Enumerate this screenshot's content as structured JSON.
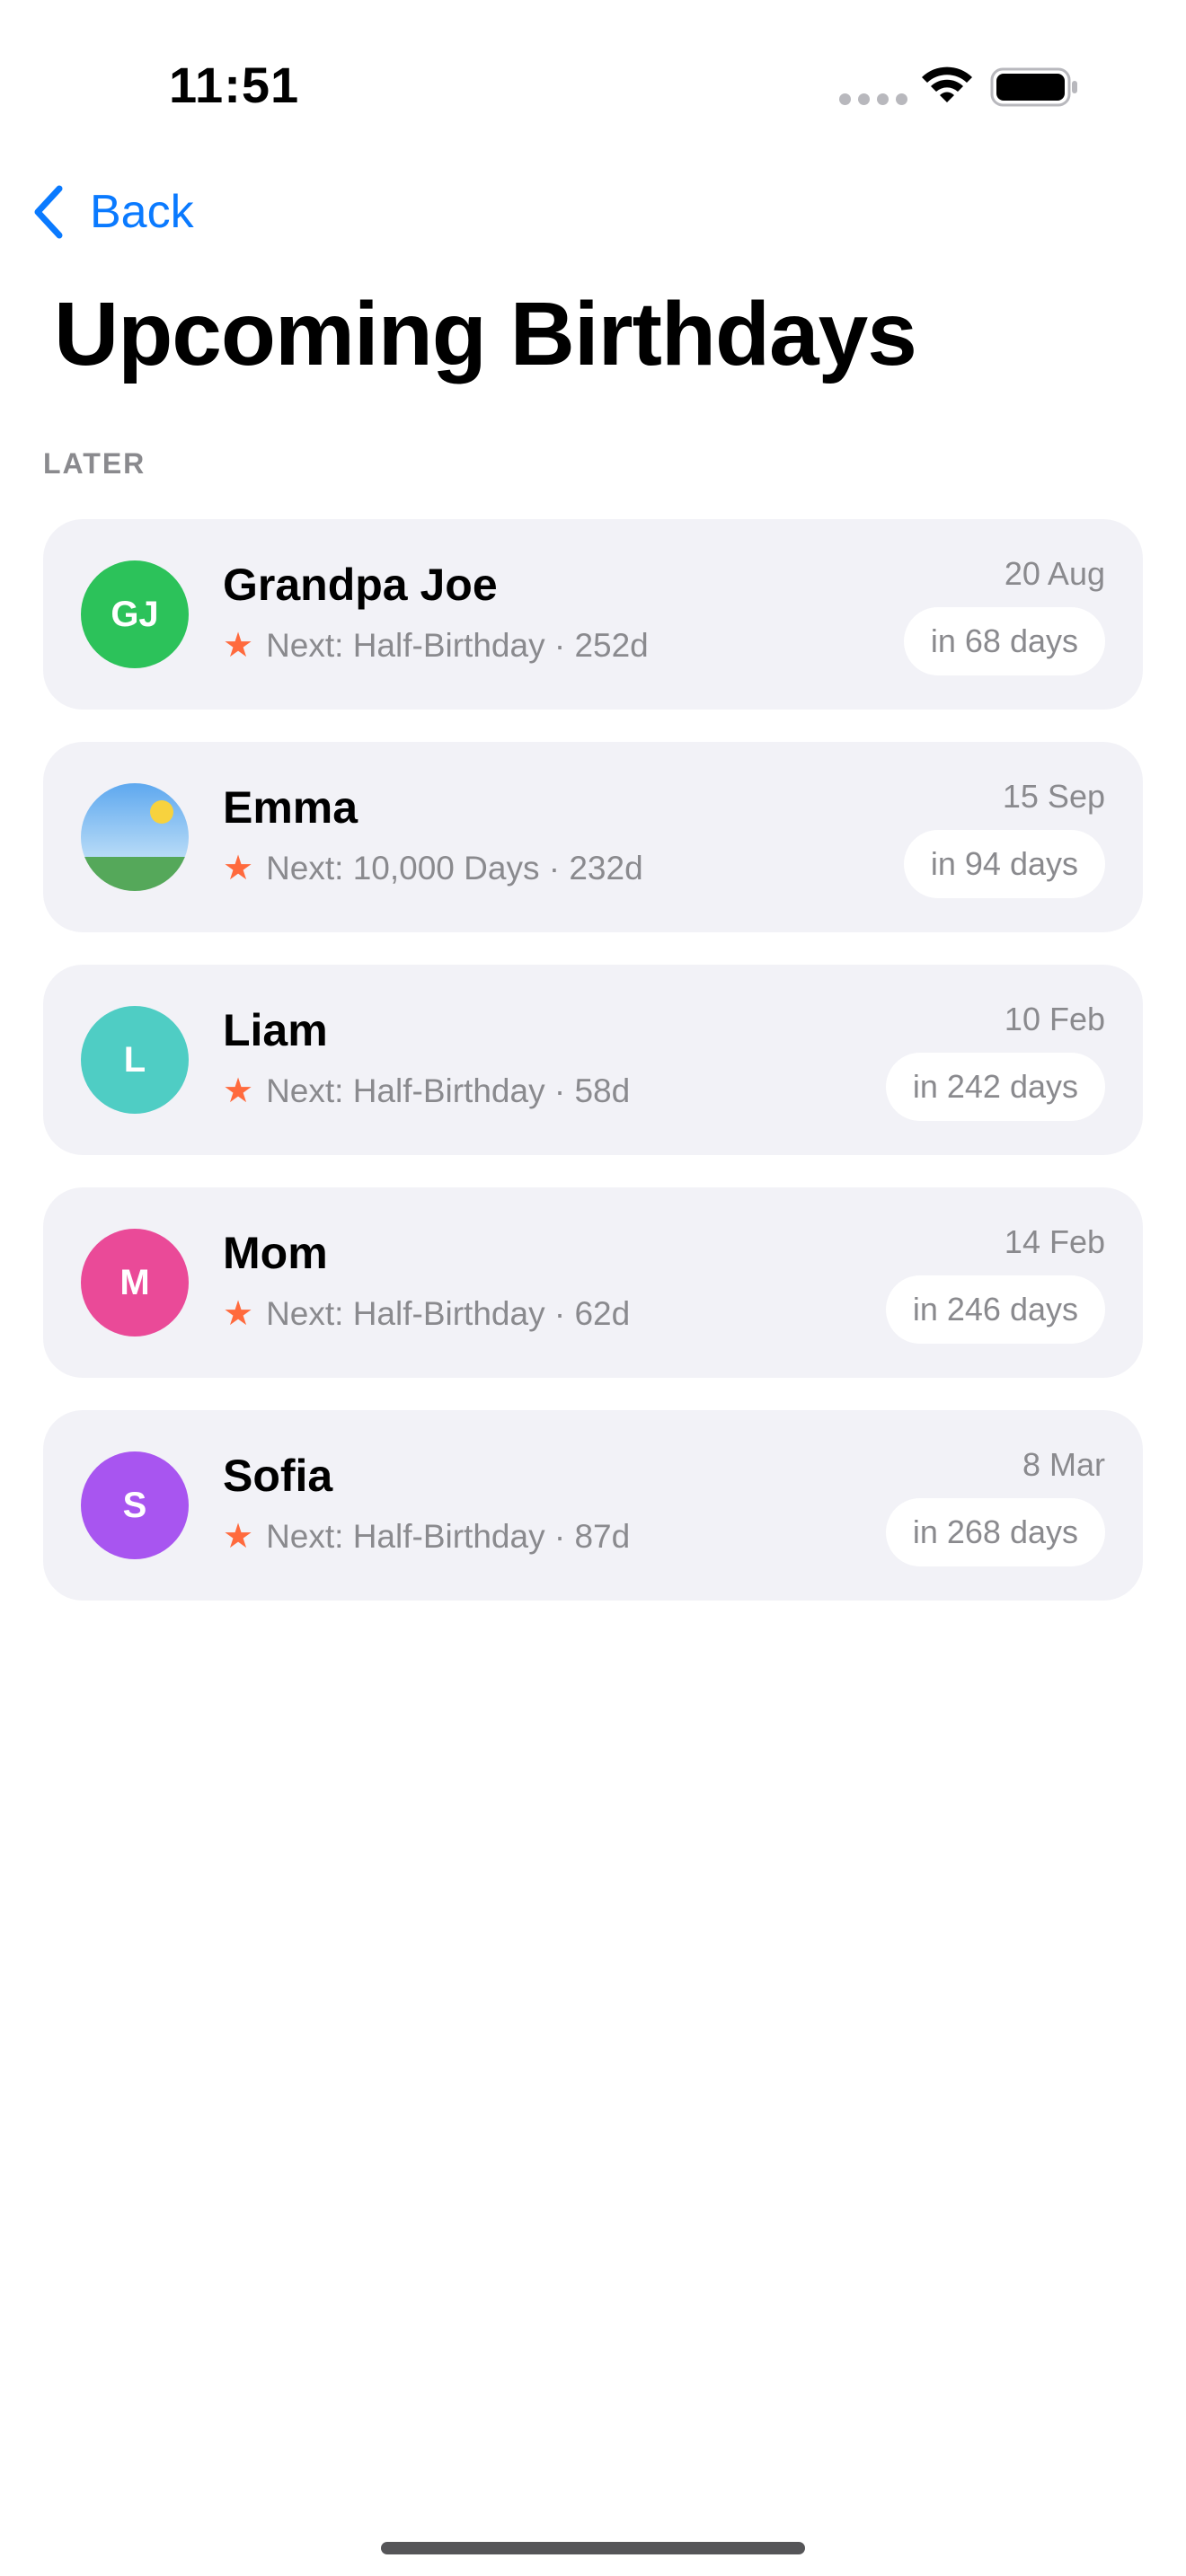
{
  "status_bar": {
    "time": "11:51"
  },
  "nav": {
    "back_label": "Back",
    "title": "Upcoming Birthdays"
  },
  "section": {
    "header": "LATER"
  },
  "colors": {
    "accent": "#0a7aff",
    "star": "#ff6a3d",
    "card_background": "#f2f2f7",
    "secondary_text": "#8a8a8e"
  },
  "people": [
    {
      "initials": "GJ",
      "name": "Grandpa Joe",
      "milestone": "Next: Half-Birthday · 252d",
      "date": "20 Aug",
      "countdown": "in 68 days",
      "avatar_color": "#2cc25a",
      "avatar_type": "initials"
    },
    {
      "initials": "",
      "name": "Emma",
      "milestone": "Next: 10,000 Days · 232d",
      "date": "15 Sep",
      "countdown": "in 94 days",
      "avatar_color": "#7ab8f0",
      "avatar_type": "photo"
    },
    {
      "initials": "L",
      "name": "Liam",
      "milestone": "Next: Half-Birthday · 58d",
      "date": "10 Feb",
      "countdown": "in 242 days",
      "avatar_color": "#4fcdc4",
      "avatar_type": "initials"
    },
    {
      "initials": "M",
      "name": "Mom",
      "milestone": "Next: Half-Birthday · 62d",
      "date": "14 Feb",
      "countdown": "in 246 days",
      "avatar_color": "#ea4a98",
      "avatar_type": "initials"
    },
    {
      "initials": "S",
      "name": "Sofia",
      "milestone": "Next: Half-Birthday · 87d",
      "date": "8 Mar",
      "countdown": "in 268 days",
      "avatar_color": "#a855f0",
      "avatar_type": "initials"
    }
  ]
}
